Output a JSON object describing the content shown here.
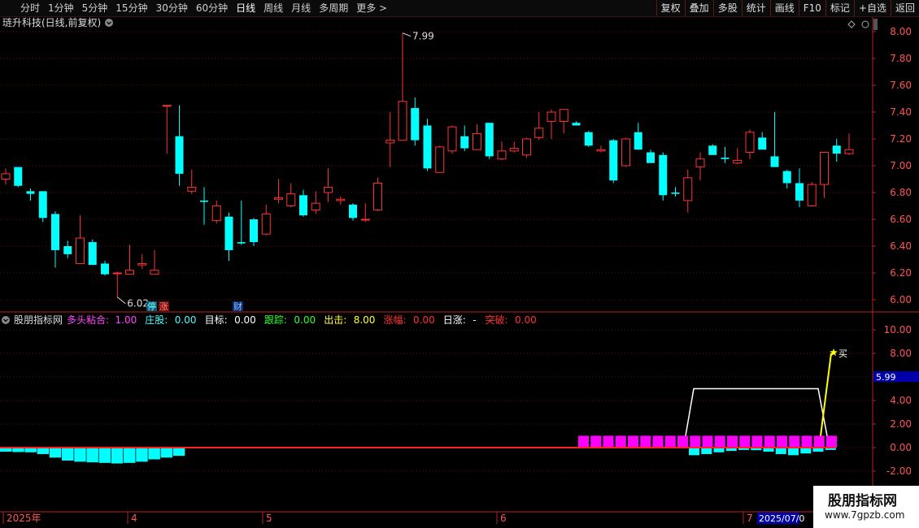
{
  "toolbar": {
    "tabs": [
      "分时",
      "1分钟",
      "5分钟",
      "15分钟",
      "30分钟",
      "60分钟",
      "日线",
      "周线",
      "月线",
      "多周期",
      "更多 >"
    ],
    "active": "日线",
    "right_buttons": [
      "复权",
      "叠加",
      "多股",
      "统计",
      "画线",
      "F10",
      "标记",
      "+自选",
      "返回"
    ]
  },
  "main_chart": {
    "title": "琏升科技(日线,前复权)",
    "y_ticks": [
      "8.00",
      "7.80",
      "7.60",
      "7.40",
      "7.20",
      "7.00",
      "6.80",
      "6.60",
      "6.40",
      "6.20",
      "6.00"
    ],
    "high_annotation": "7.99",
    "low_annotation": "6.02",
    "badges": [
      {
        "text": "停",
        "type": "cyan"
      },
      {
        "text": "涨",
        "type": "red"
      },
      {
        "text": "财",
        "type": "blue"
      }
    ]
  },
  "indicator": {
    "title": "股朋指标网",
    "labels": [
      {
        "name": "多头粘合:",
        "value": "1.00",
        "color": "#ff44ff"
      },
      {
        "name": "庄股:",
        "value": "0.00",
        "color": "#44ffff"
      },
      {
        "name": "目标:",
        "value": "0.00",
        "color": "#ffffff"
      },
      {
        "name": "跟踪:",
        "value": "0.00",
        "color": "#33ff33"
      },
      {
        "name": "出击:",
        "value": "8.00",
        "color": "#ffff33"
      },
      {
        "name": "涨幅:",
        "value": "0.00",
        "color": "#ff3333"
      },
      {
        "name": "日涨:",
        "value": "-",
        "color": "#ffffff"
      },
      {
        "name": "突破:",
        "value": "0.00",
        "color": "#ff3333"
      }
    ],
    "y_ticks": [
      "10.00",
      "8.00",
      "6.00",
      "4.00",
      "2.00",
      "0.00",
      "-2.00"
    ],
    "current_value": "5.99",
    "buy_marker": "买"
  },
  "date_axis": [
    "2025年",
    "4",
    "5",
    "6",
    "7",
    "2025/07/0"
  ],
  "watermark": {
    "line1": "股朋指标网",
    "line2": "www.7gpzb.com"
  },
  "colors": {
    "up": "#ff3232",
    "down": "#00ffff",
    "grid": "#6a1010",
    "axis": "#b22222",
    "magenta": "#ff00ff",
    "yellow": "#ffff00"
  },
  "chart_data": {
    "type": "candlestick",
    "ylim": [
      6.0,
      8.0
    ],
    "candles": [
      {
        "o": 6.9,
        "h": 6.98,
        "l": 6.86,
        "c": 6.94
      },
      {
        "o": 6.99,
        "h": 6.99,
        "l": 6.84,
        "c": 6.85
      },
      {
        "o": 6.81,
        "h": 6.83,
        "l": 6.74,
        "c": 6.79
      },
      {
        "o": 6.81,
        "h": 6.81,
        "l": 6.58,
        "c": 6.61
      },
      {
        "o": 6.64,
        "h": 6.66,
        "l": 6.24,
        "c": 6.37
      },
      {
        "o": 6.4,
        "h": 6.44,
        "l": 6.31,
        "c": 6.34
      },
      {
        "o": 6.27,
        "h": 6.63,
        "l": 6.27,
        "c": 6.46
      },
      {
        "o": 6.43,
        "h": 6.45,
        "l": 6.26,
        "c": 6.26
      },
      {
        "o": 6.27,
        "h": 6.29,
        "l": 6.18,
        "c": 6.19
      },
      {
        "o": 6.2,
        "h": 6.21,
        "l": 6.02,
        "c": 6.2
      },
      {
        "o": 6.19,
        "h": 6.41,
        "l": 6.19,
        "c": 6.22
      },
      {
        "o": 6.26,
        "h": 6.34,
        "l": 6.23,
        "c": 6.27
      },
      {
        "o": 6.19,
        "h": 6.37,
        "l": 6.19,
        "c": 6.22
      },
      {
        "o": 7.45,
        "h": 7.45,
        "l": 7.09,
        "c": 7.45
      },
      {
        "o": 7.22,
        "h": 7.45,
        "l": 6.85,
        "c": 6.94
      },
      {
        "o": 6.81,
        "h": 6.97,
        "l": 6.79,
        "c": 6.84
      },
      {
        "o": 6.74,
        "h": 6.84,
        "l": 6.56,
        "c": 6.73
      },
      {
        "o": 6.59,
        "h": 6.74,
        "l": 6.57,
        "c": 6.7
      },
      {
        "o": 6.62,
        "h": 6.65,
        "l": 6.29,
        "c": 6.37
      },
      {
        "o": 6.43,
        "h": 6.74,
        "l": 6.41,
        "c": 6.42
      },
      {
        "o": 6.6,
        "h": 6.61,
        "l": 6.4,
        "c": 6.43
      },
      {
        "o": 6.49,
        "h": 6.71,
        "l": 6.48,
        "c": 6.64
      },
      {
        "o": 6.75,
        "h": 6.9,
        "l": 6.72,
        "c": 6.76
      },
      {
        "o": 6.7,
        "h": 6.87,
        "l": 6.69,
        "c": 6.79
      },
      {
        "o": 6.78,
        "h": 6.82,
        "l": 6.62,
        "c": 6.63
      },
      {
        "o": 6.67,
        "h": 6.81,
        "l": 6.64,
        "c": 6.72
      },
      {
        "o": 6.8,
        "h": 6.98,
        "l": 6.73,
        "c": 6.84
      },
      {
        "o": 6.74,
        "h": 6.77,
        "l": 6.71,
        "c": 6.75
      },
      {
        "o": 6.71,
        "h": 6.72,
        "l": 6.59,
        "c": 6.61
      },
      {
        "o": 6.6,
        "h": 6.72,
        "l": 6.58,
        "c": 6.6
      },
      {
        "o": 6.67,
        "h": 6.91,
        "l": 6.66,
        "c": 6.87
      },
      {
        "o": 7.17,
        "h": 7.4,
        "l": 6.99,
        "c": 7.19
      },
      {
        "o": 7.19,
        "h": 7.99,
        "l": 7.19,
        "c": 7.48
      },
      {
        "o": 7.43,
        "h": 7.51,
        "l": 7.15,
        "c": 7.19
      },
      {
        "o": 7.3,
        "h": 7.35,
        "l": 6.96,
        "c": 6.98
      },
      {
        "o": 6.95,
        "h": 7.15,
        "l": 6.95,
        "c": 7.14
      },
      {
        "o": 7.11,
        "h": 7.3,
        "l": 7.09,
        "c": 7.29
      },
      {
        "o": 7.22,
        "h": 7.3,
        "l": 7.11,
        "c": 7.13
      },
      {
        "o": 7.12,
        "h": 7.31,
        "l": 7.12,
        "c": 7.24
      },
      {
        "o": 7.32,
        "h": 7.32,
        "l": 7.05,
        "c": 7.07
      },
      {
        "o": 7.05,
        "h": 7.18,
        "l": 7.04,
        "c": 7.11
      },
      {
        "o": 7.11,
        "h": 7.18,
        "l": 7.1,
        "c": 7.13
      },
      {
        "o": 7.08,
        "h": 7.21,
        "l": 7.06,
        "c": 7.2
      },
      {
        "o": 7.21,
        "h": 7.4,
        "l": 7.19,
        "c": 7.28
      },
      {
        "o": 7.33,
        "h": 7.42,
        "l": 7.2,
        "c": 7.4
      },
      {
        "o": 7.33,
        "h": 7.42,
        "l": 7.24,
        "c": 7.42
      },
      {
        "o": 7.32,
        "h": 7.33,
        "l": 7.3,
        "c": 7.3
      },
      {
        "o": 7.25,
        "h": 7.26,
        "l": 7.14,
        "c": 7.15
      },
      {
        "o": 7.11,
        "h": 7.15,
        "l": 7.1,
        "c": 7.12
      },
      {
        "o": 7.19,
        "h": 7.2,
        "l": 6.87,
        "c": 6.89
      },
      {
        "o": 7.0,
        "h": 7.21,
        "l": 6.99,
        "c": 7.2
      },
      {
        "o": 7.25,
        "h": 7.32,
        "l": 7.12,
        "c": 7.12
      },
      {
        "o": 7.1,
        "h": 7.12,
        "l": 7.02,
        "c": 7.02
      },
      {
        "o": 7.08,
        "h": 7.1,
        "l": 6.74,
        "c": 6.78
      },
      {
        "o": 6.8,
        "h": 6.84,
        "l": 6.77,
        "c": 6.79
      },
      {
        "o": 6.74,
        "h": 6.97,
        "l": 6.65,
        "c": 6.91
      },
      {
        "o": 6.99,
        "h": 7.1,
        "l": 6.89,
        "c": 7.05
      },
      {
        "o": 7.15,
        "h": 7.16,
        "l": 7.08,
        "c": 7.08
      },
      {
        "o": 7.06,
        "h": 7.14,
        "l": 7.02,
        "c": 7.05
      },
      {
        "o": 7.02,
        "h": 7.13,
        "l": 7.01,
        "c": 7.04
      },
      {
        "o": 7.1,
        "h": 7.27,
        "l": 7.05,
        "c": 7.25
      },
      {
        "o": 7.21,
        "h": 7.25,
        "l": 7.13,
        "c": 7.12
      },
      {
        "o": 7.07,
        "h": 7.4,
        "l": 6.99,
        "c": 6.99
      },
      {
        "o": 6.96,
        "h": 6.97,
        "l": 6.83,
        "c": 6.87
      },
      {
        "o": 6.87,
        "h": 6.98,
        "l": 6.69,
        "c": 6.74
      },
      {
        "o": 6.7,
        "h": 6.88,
        "l": 6.7,
        "c": 6.86
      },
      {
        "o": 6.86,
        "h": 7.1,
        "l": 6.76,
        "c": 7.1
      },
      {
        "o": 7.15,
        "h": 7.2,
        "l": 7.03,
        "c": 7.09
      },
      {
        "o": 7.09,
        "h": 7.24,
        "l": 7.08,
        "c": 7.12
      }
    ],
    "indicator_ylim": [
      -3,
      11
    ],
    "histogram_left": [
      -0.35,
      -0.38,
      -0.4,
      -0.55,
      -0.85,
      -1.1,
      -1.2,
      -1.25,
      -1.3,
      -1.35,
      -1.3,
      -1.2,
      -1.0,
      -0.85,
      -0.7
    ],
    "magenta_bars_count": 21,
    "cyan_right": [
      -0.65,
      -0.55,
      -0.4,
      -0.28,
      -0.2,
      -0.22,
      -0.35,
      -0.55,
      -0.65,
      -0.5,
      -0.35,
      -0.2
    ],
    "white_step": [
      [
        1.0,
        0
      ],
      [
        1.0,
        5.0
      ],
      [
        1.0,
        5.0
      ],
      [
        5.0,
        5.0
      ],
      [
        5.0,
        1.0
      ]
    ],
    "yellow_line": {
      "from": 1.0,
      "to": 8.0
    }
  }
}
